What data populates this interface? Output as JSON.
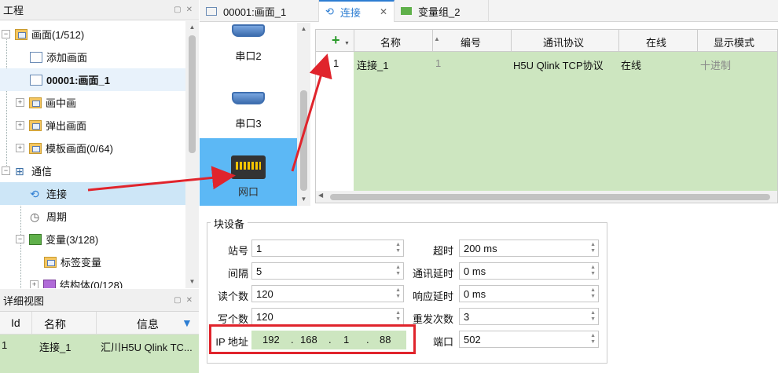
{
  "project_panel": {
    "title": "工程",
    "tree": [
      {
        "label": "画面(1/512)"
      },
      {
        "label": "添加画面"
      },
      {
        "label": "00001:画面_1"
      },
      {
        "label": "画中画"
      },
      {
        "label": "弹出画面"
      },
      {
        "label": "模板画面(0/64)"
      },
      {
        "label": "通信"
      },
      {
        "label": "连接"
      },
      {
        "label": "周期"
      },
      {
        "label": "变量(3/128)"
      },
      {
        "label": "标签变量"
      },
      {
        "label": "结构体(0/128)"
      }
    ]
  },
  "detail_panel": {
    "title": "详细视图",
    "columns": [
      "Id",
      "名称",
      "信息"
    ],
    "row": {
      "id": "1",
      "name": "连接_1",
      "info": "汇川H5U Qlink TC..."
    }
  },
  "tabs": [
    {
      "label": "00001:画面_1"
    },
    {
      "label": "连接"
    },
    {
      "label": "变量组_2"
    }
  ],
  "devices": [
    {
      "label": "串口2"
    },
    {
      "label": "串口3"
    },
    {
      "label": "网口"
    }
  ],
  "grid": {
    "add_icon": "+",
    "columns": [
      "名称",
      "编号",
      "通讯协议",
      "在线",
      "显示模式"
    ],
    "row": {
      "num": "1",
      "name": "连接_1",
      "id": "1",
      "protocol": "H5U Qlink TCP协议",
      "online": "在线",
      "mode": "十进制"
    }
  },
  "block_device": {
    "title": "块设备",
    "fields": {
      "station": {
        "label": "站号",
        "value": "1"
      },
      "interval": {
        "label": "间隔",
        "value": "5"
      },
      "read_count": {
        "label": "读个数",
        "value": "120"
      },
      "write_count": {
        "label": "写个数",
        "value": "120"
      },
      "timeout": {
        "label": "超时",
        "value": "200 ms"
      },
      "comm_delay": {
        "label": "通讯延时",
        "value": "0 ms"
      },
      "resp_delay": {
        "label": "响应延时",
        "value": "0 ms"
      },
      "retries": {
        "label": "重发次数",
        "value": "3"
      },
      "ip": {
        "label": "IP 地址",
        "octets": [
          "192",
          "168",
          "1",
          "88"
        ]
      },
      "port": {
        "label": "端口",
        "value": "502"
      }
    }
  },
  "colors": {
    "accent": "#2d7dd2",
    "selection": "#5cb8f5",
    "row_green": "#cde6c0",
    "annotation_red": "#e0242c"
  }
}
